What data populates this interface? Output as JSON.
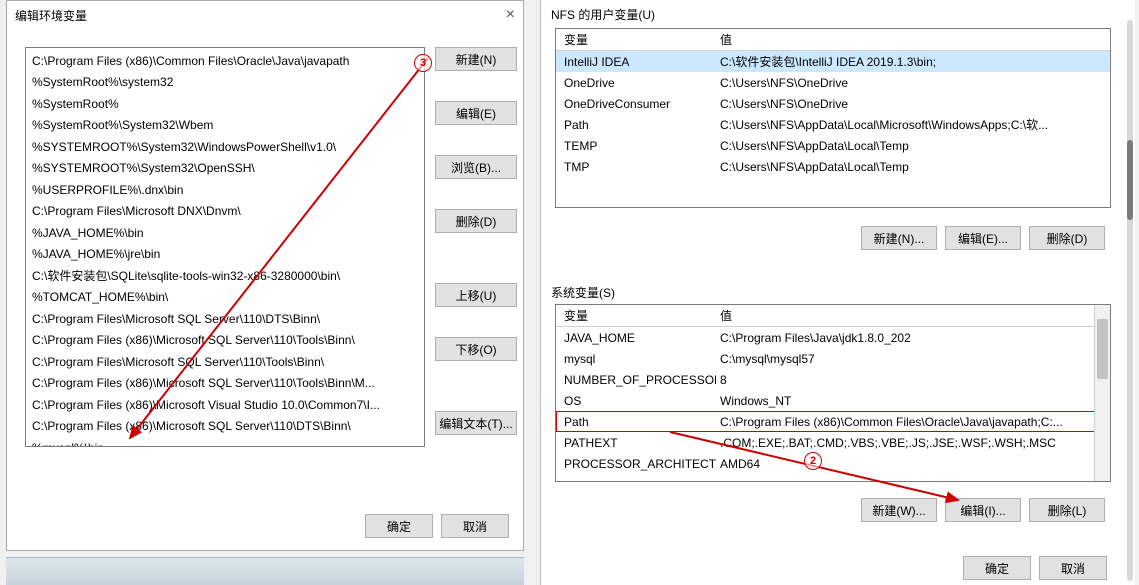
{
  "editDialog": {
    "title": "编辑环境变量",
    "paths": [
      "C:\\Program Files (x86)\\Common Files\\Oracle\\Java\\javapath",
      "%SystemRoot%\\system32",
      "%SystemRoot%",
      "%SystemRoot%\\System32\\Wbem",
      "%SYSTEMROOT%\\System32\\WindowsPowerShell\\v1.0\\",
      "%SYSTEMROOT%\\System32\\OpenSSH\\",
      "%USERPROFILE%\\.dnx\\bin",
      "C:\\Program Files\\Microsoft DNX\\Dnvm\\",
      "%JAVA_HOME%\\bin",
      "%JAVA_HOME%\\jre\\bin",
      "C:\\软件安装包\\SQLite\\sqlite-tools-win32-x86-3280000\\bin\\",
      "%TOMCAT_HOME%\\bin\\",
      "C:\\Program Files\\Microsoft SQL Server\\110\\DTS\\Binn\\",
      "C:\\Program Files (x86)\\Microsoft SQL Server\\110\\Tools\\Binn\\",
      "C:\\Program Files\\Microsoft SQL Server\\110\\Tools\\Binn\\",
      "C:\\Program Files (x86)\\Microsoft SQL Server\\110\\Tools\\Binn\\M...",
      "C:\\Program Files (x86)\\Microsoft Visual Studio 10.0\\Common7\\I...",
      "C:\\Program Files (x86)\\Microsoft SQL Server\\110\\DTS\\Binn\\",
      "%mysql%\\bin"
    ],
    "buttons": {
      "new": "新建(N)",
      "edit": "编辑(E)",
      "browse": "浏览(B)...",
      "delete": "删除(D)",
      "moveUp": "上移(U)",
      "moveDown": "下移(O)",
      "editText": "编辑文本(T)...",
      "ok": "确定",
      "cancel": "取消"
    }
  },
  "envPanel": {
    "userLabel": "NFS 的用户变量(U)",
    "sysLabel": "系统变量(S)",
    "hdrVar": "变量",
    "hdrVal": "值",
    "userVars": [
      {
        "name": "IntelliJ IDEA",
        "value": "C:\\软件安装包\\IntelliJ IDEA 2019.1.3\\bin;"
      },
      {
        "name": "OneDrive",
        "value": "C:\\Users\\NFS\\OneDrive"
      },
      {
        "name": "OneDriveConsumer",
        "value": "C:\\Users\\NFS\\OneDrive"
      },
      {
        "name": "Path",
        "value": "C:\\Users\\NFS\\AppData\\Local\\Microsoft\\WindowsApps;C:\\软..."
      },
      {
        "name": "TEMP",
        "value": "C:\\Users\\NFS\\AppData\\Local\\Temp"
      },
      {
        "name": "TMP",
        "value": "C:\\Users\\NFS\\AppData\\Local\\Temp"
      }
    ],
    "sysVars": [
      {
        "name": "JAVA_HOME",
        "value": "C:\\Program Files\\Java\\jdk1.8.0_202"
      },
      {
        "name": "mysql",
        "value": "C:\\mysql\\mysql57"
      },
      {
        "name": "NUMBER_OF_PROCESSORS",
        "value": "8"
      },
      {
        "name": "OS",
        "value": "Windows_NT"
      },
      {
        "name": "Path",
        "value": "C:\\Program Files (x86)\\Common Files\\Oracle\\Java\\javapath;C:..."
      },
      {
        "name": "PATHEXT",
        "value": ".COM;.EXE;.BAT;.CMD;.VBS;.VBE;.JS;.JSE;.WSF;.WSH;.MSC"
      },
      {
        "name": "PROCESSOR_ARCHITECT...",
        "value": "AMD64"
      }
    ],
    "sysPathIndex": 4,
    "userSelectedIndex": 0,
    "buttons": {
      "newUser": "新建(N)...",
      "editUser": "编辑(E)...",
      "deleteUser": "删除(D)",
      "newSys": "新建(W)...",
      "editSys": "编辑(I)...",
      "deleteSys": "删除(L)",
      "ok": "确定",
      "cancel": "取消"
    }
  },
  "annotations": {
    "n2": "2",
    "n3": "3"
  }
}
